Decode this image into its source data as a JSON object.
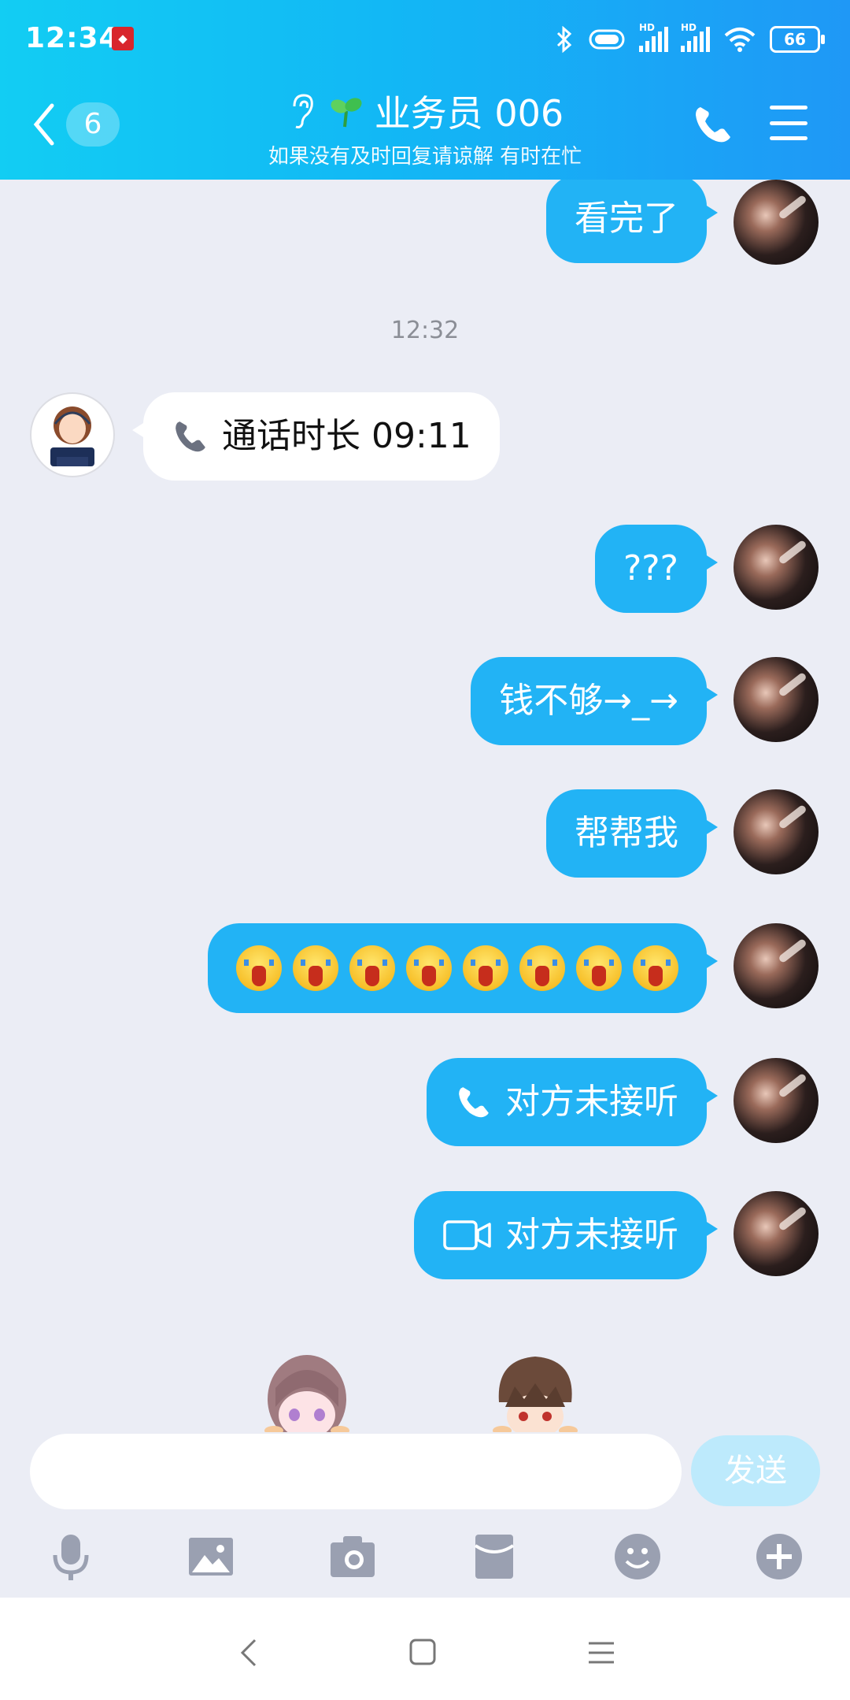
{
  "status_bar": {
    "time": "12:34",
    "battery": "66",
    "hd1": "HD",
    "hd2": "HD"
  },
  "header": {
    "unread_count": "6",
    "title": "业务员 006",
    "subtitle": "如果没有及时回复请谅解 有时在忙"
  },
  "messages": [
    {
      "dir": "out",
      "text": "看完了"
    },
    {
      "type": "time",
      "text": "12:32"
    },
    {
      "dir": "in",
      "icon": "phone-icon",
      "text": "通话时长 09:11"
    },
    {
      "dir": "out",
      "text": "???"
    },
    {
      "dir": "out",
      "text": "钱不够→_→"
    },
    {
      "dir": "out",
      "text": "帮帮我"
    },
    {
      "dir": "out",
      "emoji_count": 8,
      "emoji": "crying-emoji"
    },
    {
      "dir": "out",
      "icon": "phone-icon",
      "text": "对方未接听"
    },
    {
      "dir": "out",
      "icon": "video-icon",
      "text": "对方未接听"
    }
  ],
  "input": {
    "placeholder": "",
    "send_label": "发送"
  },
  "toolbar": [
    "microphone-icon",
    "image-icon",
    "camera-icon",
    "red-packet-icon",
    "emoji-icon",
    "plus-icon"
  ],
  "colors": {
    "header_start": "#12cdf3",
    "header_end": "#1f98f6",
    "bubble_out": "#22b3f5",
    "background": "#ebedf5"
  }
}
